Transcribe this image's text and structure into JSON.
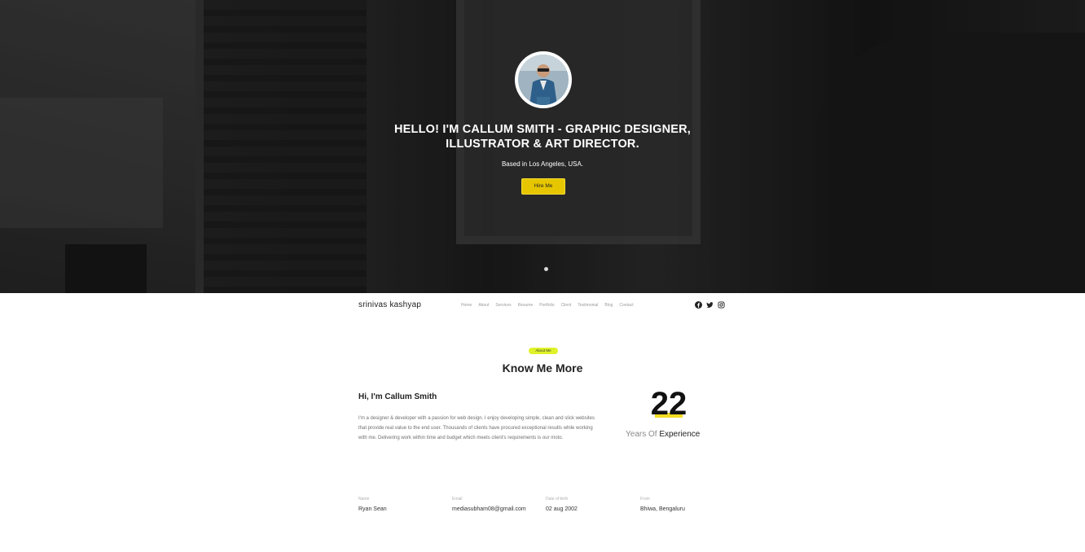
{
  "hero": {
    "title_line1": "HELLO! I'M CALLUM SMITH - GRAPHIC DESIGNER,",
    "title_line2": "ILLUSTRATOR & ART DIRECTOR.",
    "subtitle": "Based in Los Angeles, USA.",
    "button_label": "Hire Me"
  },
  "nav": {
    "brand": "srinivas kashyap",
    "links": [
      "Home",
      "About",
      "Services",
      "Resume",
      "Portfolio",
      "Client",
      "Testimonial",
      "Blog",
      "Contact"
    ],
    "social_icons": [
      "facebook-icon",
      "twitter-icon",
      "instagram-icon"
    ]
  },
  "about": {
    "badge": "About Me",
    "title": "Know Me More",
    "greeting": "Hi, I'm Callum Smith",
    "bio": "I'm a designer & developer with a passion for web design. I enjoy developing simple, clean and slick websites that provide real value to the end user. Thousands of clients have procured exceptional results while working with me. Delivering work within time and budget which meets client's requirements is our moto.",
    "experience_number": "22",
    "experience_label_plain": "Years Of",
    "experience_label_strong": "Experience"
  },
  "info": [
    {
      "label": "Name",
      "value": "Ryan Sean"
    },
    {
      "label": "Email",
      "value": "mediasubham08@gmail.com"
    },
    {
      "label": "Date of birth",
      "value": "02 aug 2002"
    },
    {
      "label": "From",
      "value": "Bhiwa, Bengaluru"
    }
  ],
  "colors": {
    "accent": "#e6c600",
    "badge": "#dff229",
    "text_dark": "#222222",
    "text_muted": "#6e6e6e"
  }
}
